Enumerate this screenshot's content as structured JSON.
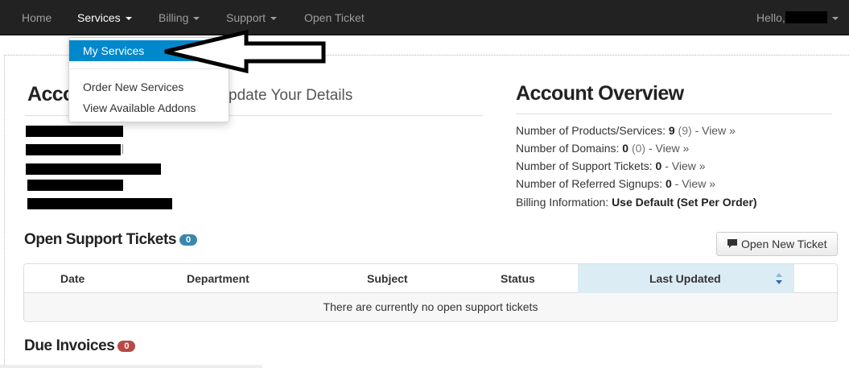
{
  "navbar": {
    "items": [
      {
        "label": "Home"
      },
      {
        "label": "Services"
      },
      {
        "label": "Billing"
      },
      {
        "label": "Support"
      },
      {
        "label": "Open Ticket"
      }
    ],
    "greeting": "Hello,"
  },
  "services_menu": {
    "items": [
      {
        "label": "My Services"
      },
      {
        "label": "Order New Services"
      },
      {
        "label": "View Available Addons"
      }
    ]
  },
  "account_info": {
    "title_visible": "Acco",
    "subtitle_visible": "pdate Your Details"
  },
  "account_overview": {
    "title": "Account Overview",
    "lines": [
      {
        "label": "Number of Products/Services:",
        "value": "9",
        "extra": "(9)",
        "link": "- View »"
      },
      {
        "label": "Number of Domains:",
        "value": "0",
        "extra": "(0)",
        "link": "- View »"
      },
      {
        "label": "Number of Support Tickets:",
        "value": "0",
        "link": "- View »"
      },
      {
        "label": "Number of Referred Signups:",
        "value": "0",
        "link": "- View »"
      }
    ],
    "billing": {
      "label": "Billing Information:",
      "value": "Use Default (Set Per Order)"
    }
  },
  "open_tickets": {
    "title": "Open Support Tickets",
    "count": "0",
    "button_label": "Open New Ticket",
    "columns": [
      "Date",
      "Department",
      "Subject",
      "Status",
      "Last Updated"
    ],
    "empty_message": "There are currently no open support tickets"
  },
  "due_invoices": {
    "title": "Due Invoices",
    "count": "0"
  },
  "colors": {
    "navbar_bg": "#222222",
    "menu_selected": "#0088cc",
    "badge_info": "#3a87ad",
    "badge_important": "#b94a48",
    "sorted_column": "#dcecf5"
  }
}
